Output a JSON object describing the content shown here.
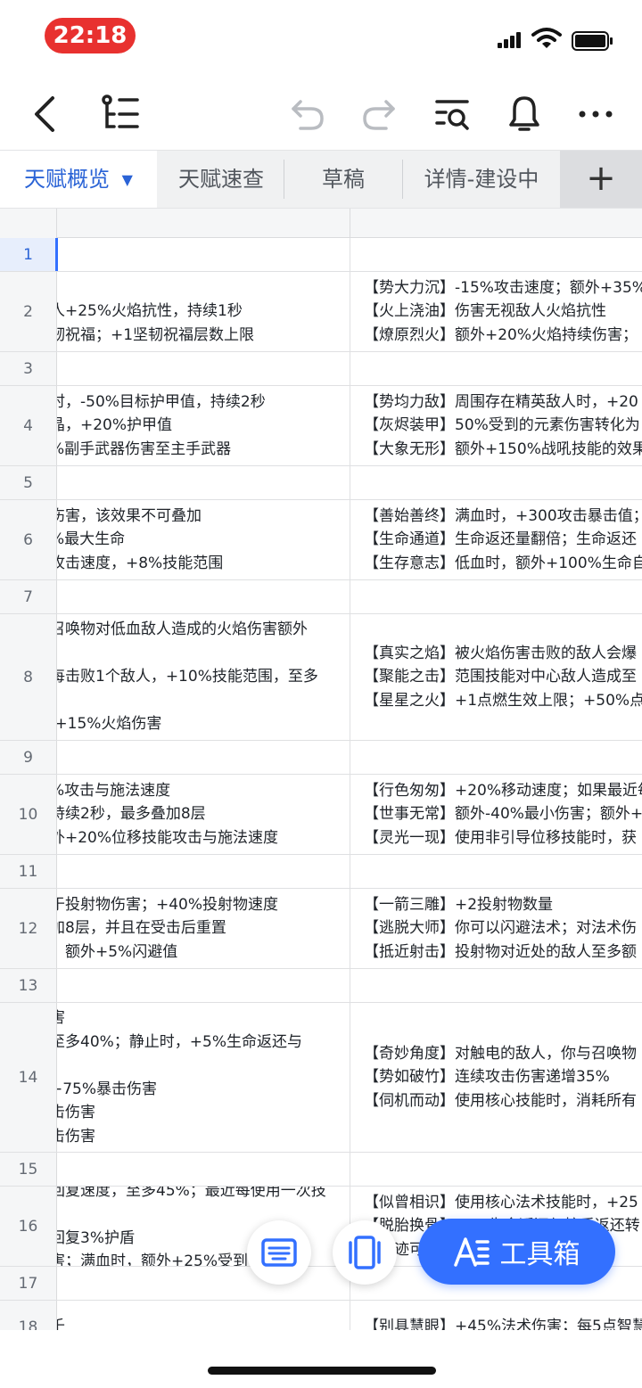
{
  "status_bar": {
    "time": "22:18"
  },
  "toolbar": {
    "icons": [
      "back-icon",
      "outline-icon",
      "undo-icon",
      "redo-icon",
      "search-icon",
      "bell-icon",
      "more-icon"
    ]
  },
  "tabs": [
    {
      "label": "天赋概览",
      "active": true
    },
    {
      "label": "天赋速查",
      "active": false
    },
    {
      "label": "草稿",
      "active": false
    },
    {
      "label": "详情-建设中",
      "active": false
    }
  ],
  "add_tab_label": "+",
  "rows": [
    {
      "num": "1",
      "c1": [],
      "c2": []
    },
    {
      "num": "2",
      "c1": [
        "、",
        "人+25%火焰抗性，持续1秒",
        "韧祝福；+1坚韧祝福层数上限"
      ],
      "c2": [
        "【势大力沉】-15%攻击速度；额外+35%",
        "【火上浇油】伤害无视敌人火焰抗性",
        "【燎原烈火】额外+20%火焰持续伤害；"
      ]
    },
    {
      "num": "3",
      "c1": [],
      "c2": []
    },
    {
      "num": "4",
      "c1": [
        "时，-50%目标护甲值，持续2秒",
        "晶，+20%护甲值",
        "%副手武器伤害至主手武器"
      ],
      "c2": [
        "【势均力敌】周围存在精英敌人时，+20",
        "【灰烬装甲】50%受到的元素伤害转化为",
        "【大象无形】额外+150%战吼技能的效果"
      ]
    },
    {
      "num": "5",
      "c1": [],
      "c2": []
    },
    {
      "num": "6",
      "c1": [
        "伤害，该效果不可叠加",
        "%最大生命",
        "攻击速度，+8%技能范围"
      ],
      "c2": [
        "【善始善终】满血时，+300攻击暴击值；",
        "【生命通道】生命返还量翻倍；生命返还",
        "【生存意志】低血时，额外+100%生命自"
      ]
    },
    {
      "num": "7",
      "c1": [],
      "c2": []
    },
    {
      "num": "8",
      "c1": [
        "召唤物对低血敌人造成的火焰伤害额外",
        "",
        "每击败1个敌人，+10%技能范围，至多",
        "",
        ",+15%火焰伤害"
      ],
      "c2": [
        "【真实之焰】被火焰伤害击败的敌人会爆",
        "【聚能之击】范围技能对中心敌人造成至",
        "【星星之火】+1点燃生效上限；+50%点"
      ]
    },
    {
      "num": "9",
      "c1": [],
      "c2": []
    },
    {
      "num": "10",
      "c1": [
        "%攻击与施法速度",
        "持续2秒，最多叠加8层",
        "外+20%位移技能攻击与施法速度"
      ],
      "c2": [
        "【行色匆匆】+20%移动速度；如果最近每",
        "【世事无常】额外-40%最小伤害；额外+",
        "【灵光一现】使用非引导位移技能时，获"
      ]
    },
    {
      "num": "11",
      "c1": [],
      "c2": []
    },
    {
      "num": "12",
      "c1": [
        "于投射物伤害；+40%投射物速度",
        "加8层，并且在受击后重置",
        "，额外+5%闪避值"
      ],
      "c2": [
        "【一箭三雕】+2投射物数量",
        "【逃脱大师】你可以闪避法术；对法术伤",
        "【抵近射击】投射物对近处的敌人至多额"
      ]
    },
    {
      "num": "13",
      "c1": [],
      "c2": []
    },
    {
      "num": "14",
      "c1": [
        "害",
        "至多40%；静止时，+5%生命返还与",
        "",
        "+75%暴击伤害",
        "击伤害",
        "击伤害"
      ],
      "c2": [
        "【奇妙角度】对触电的敌人，你与召唤物",
        "【势如破竹】连续攻击伤害递增35%",
        "【伺机而动】使用核心技能时，消耗所有"
      ]
    },
    {
      "num": "15",
      "c1": [],
      "c2": []
    },
    {
      "num": "16",
      "c1": [
        "回复速度，至多45%；最近每使用一次技",
        "",
        "回复3%护盾",
        "害；满血时，额外+25%受到"
      ],
      "c2": [
        "【似曾相识】使用核心法术技能时，+25",
        "【脱胎换骨】50%生命返还与护盾返还转",
        "【奇迹可见】…………获得"
      ]
    },
    {
      "num": "17",
      "c1": [],
      "c2": []
    },
    {
      "num": "18",
      "c1": [
        "千"
      ],
      "c2": [
        "【别具慧眼】+45%法术伤害；每5点智慧"
      ]
    }
  ],
  "fab": {
    "keyboard_icon": "keyboard-icon",
    "panel_icon": "page-icon",
    "toolbox_label": "工具箱"
  }
}
